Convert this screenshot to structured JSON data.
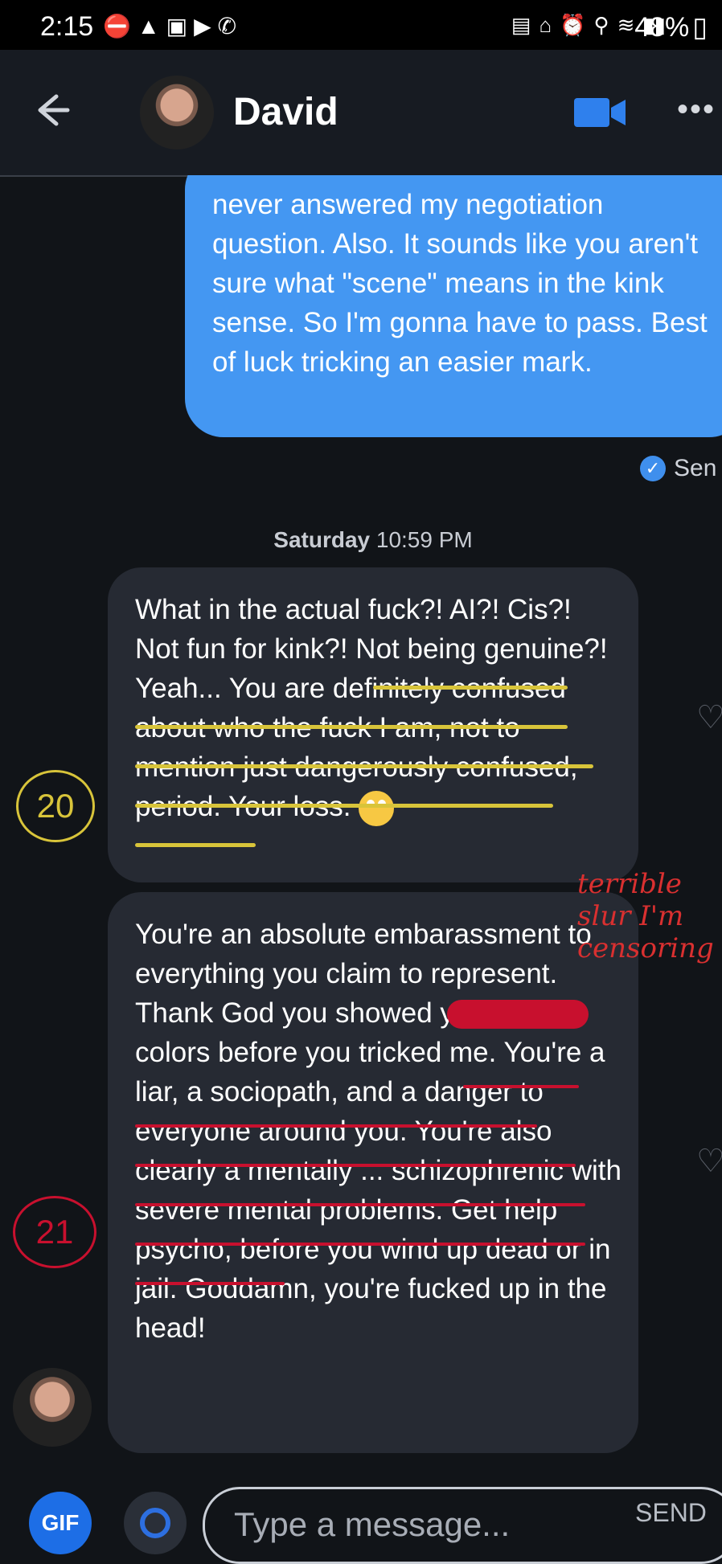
{
  "statusbar": {
    "time": "2:15",
    "battery": "48%"
  },
  "header": {
    "name": "David"
  },
  "messages": [
    {
      "type": "outgoing",
      "text": "never answered my negotiation question. Also. It sounds like you aren't sure what \"scene\" means in the kink sense. So I'm gonna have to pass. Best of luck tricking an easier mark."
    },
    {
      "type": "incoming",
      "text": "What in the actual fuck?! AI?! Cis?! Not fun for kink?! Not being genuine?! Yeah... You are definitely confused about who the fuck I am, not to mention just dangerously confused, period. Your loss."
    },
    {
      "type": "incoming",
      "text": "You're an absolute embarassment to everything you claim to represent. Thank God you showed your true colors before you tricked me. You're a liar, a sociopath, and a danger to everyone around you. You're also clearly a mentally ... schizophrenic with severe mental problems. Get help psycho, before you wind up dead or in jail. Goddamn, you're fucked up in the head!"
    }
  ],
  "status": {
    "sent_label": "Sen"
  },
  "date_label": {
    "day": "Saturday",
    "time": "10:59 PM"
  },
  "annotations": {
    "num20": "20",
    "num21": "21",
    "margin_note": "terrible slur I'm censoring"
  },
  "composer": {
    "gif": "GIF",
    "placeholder": "Type a message...",
    "send": "SEND"
  }
}
